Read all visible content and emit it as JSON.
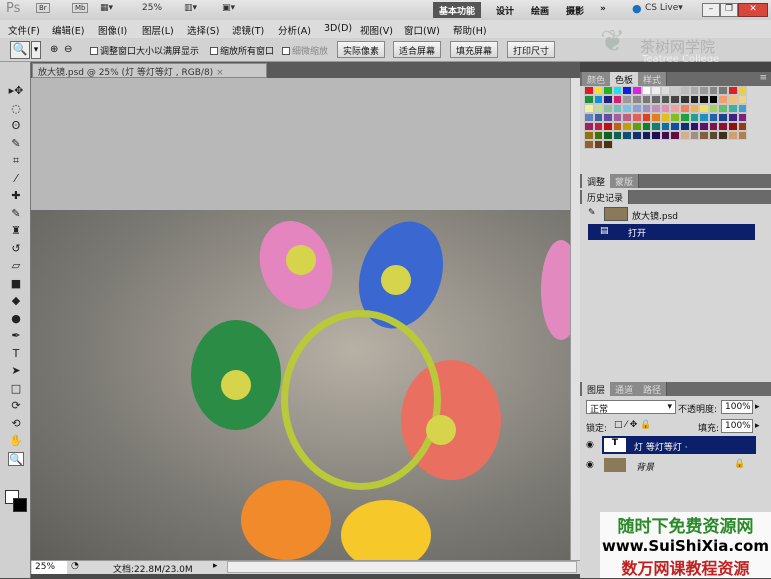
{
  "titlebar": {
    "app_logo": "Ps",
    "br": "Br",
    "mb": "Mb",
    "zoom": "25%",
    "workspaces": [
      "基本功能",
      "设计",
      "绘画",
      "摄影"
    ],
    "more": "»",
    "cs_live": "CS Live▾"
  },
  "menu": [
    "文件(F)",
    "编辑(E)",
    "图像(I)",
    "图层(L)",
    "选择(S)",
    "滤镜(T)",
    "分析(A)",
    "3D(D)",
    "视图(V)",
    "窗口(W)",
    "帮助(H)"
  ],
  "options": {
    "checks": [
      "调整窗口大小以满屏显示",
      "缩放所有窗口",
      "细微缩放"
    ],
    "buttons": [
      "实际像素",
      "适合屏幕",
      "填充屏幕",
      "打印尺寸"
    ]
  },
  "logo_watermark": {
    "cn": "茶树网学院",
    "en": "Teatree College"
  },
  "document": {
    "tab": "放大镜.psd @ 25% (灯  等灯等灯 , RGB/8)",
    "close": "×"
  },
  "status": {
    "zoom": "25%",
    "doc": "文档:22.8M/23.0M"
  },
  "panels": {
    "swatch_tabs": [
      "颜色",
      "色板",
      "样式"
    ],
    "adjust_tabs": [
      "调整",
      "蒙版"
    ],
    "history_tab": "历史记录",
    "history": {
      "snapshot": "放大镜.psd",
      "items": [
        "打开"
      ]
    },
    "layers_tabs": [
      "图层",
      "通道",
      "路径"
    ],
    "blend_mode": "正常",
    "opacity_label": "不透明度:",
    "opacity": "100%",
    "lock_label": "锁定:",
    "fill_label": "填充:",
    "fill": "100%",
    "layers": [
      {
        "name": "灯  等灯等灯 ·",
        "type": "T",
        "selected": true
      },
      {
        "name": "背景",
        "type": "image",
        "selected": false
      }
    ]
  },
  "swatch_colors": [
    "#e31a1c",
    "#f5e31a",
    "#1fb51f",
    "#1ee0f0",
    "#1020d8",
    "#e020e0",
    "#ffffff",
    "#eeeeee",
    "#dddddd",
    "#cccccc",
    "#bbbbbb",
    "#aaaaaa",
    "#999999",
    "#888888",
    "#777777",
    "#e02020",
    "#f0d020",
    "#1a9040",
    "#1890d0",
    "#202080",
    "#d02070",
    "#999999",
    "#888888",
    "#777777",
    "#666666",
    "#555555",
    "#444444",
    "#333333",
    "#222222",
    "#111111",
    "#000000",
    "#f0a070",
    "#f0c080",
    "#f0d090",
    "#f0f0a0",
    "#c0e090",
    "#90c0a0",
    "#70c0c0",
    "#80c0e0",
    "#90a0d0",
    "#a090c0",
    "#c090c0",
    "#e090b0",
    "#f0a0a0",
    "#f08060",
    "#f0b050",
    "#f0e060",
    "#a0d060",
    "#60c070",
    "#40b0a0",
    "#40a0d0",
    "#6080c0",
    "#4060a0",
    "#6050a0",
    "#a060a0",
    "#c06080",
    "#e06060",
    "#e04020",
    "#e08020",
    "#e0c020",
    "#80c020",
    "#20a040",
    "#20a090",
    "#2090c0",
    "#2060b0",
    "#204090",
    "#402080",
    "#802080",
    "#a02060",
    "#c02040",
    "#c01010",
    "#c06010",
    "#c0a010",
    "#60a010",
    "#108030",
    "#108070",
    "#1070a0",
    "#1050a0",
    "#103070",
    "#301070",
    "#601070",
    "#801050",
    "#901030",
    "#901010",
    "#904010",
    "#907010",
    "#407010",
    "#106020",
    "#106050",
    "#105070",
    "#103070",
    "#102050",
    "#200e50",
    "#400e50",
    "#600e40",
    "#d0b090",
    "#a09080",
    "#806040",
    "#604830",
    "#403020",
    "#d0a070",
    "#b08050",
    "#906030",
    "#704020",
    "#503010"
  ]
}
